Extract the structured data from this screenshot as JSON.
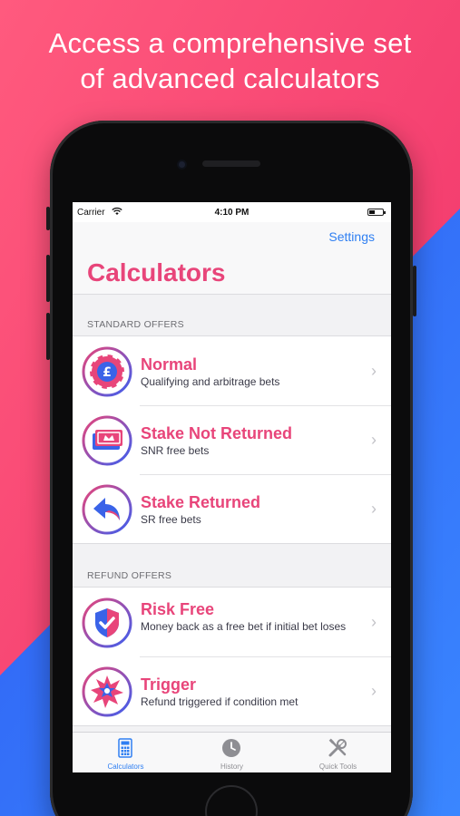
{
  "headline": {
    "line1": "Access a comprehensive set",
    "line2": "of advanced calculators"
  },
  "colors": {
    "accent_pink": "#e8457a",
    "link_blue": "#2f7ff2",
    "bg_pink": "#f0446f",
    "bg_blue": "#2f63f0"
  },
  "status_bar": {
    "carrier": "Carrier",
    "time": "4:10 PM"
  },
  "nav": {
    "settings_label": "Settings",
    "title": "Calculators"
  },
  "sections": [
    {
      "header": "STANDARD OFFERS",
      "rows": [
        {
          "title": "Normal",
          "subtitle": "Qualifying and arbitrage bets",
          "icon": "poker-chip-icon"
        },
        {
          "title": "Stake Not Returned",
          "subtitle": "SNR free bets",
          "icon": "banknote-icon"
        },
        {
          "title": "Stake Returned",
          "subtitle": "SR free bets",
          "icon": "return-arrow-icon"
        }
      ]
    },
    {
      "header": "REFUND OFFERS",
      "rows": [
        {
          "title": "Risk Free",
          "subtitle": "Money back as a free bet if initial bet loses",
          "icon": "shield-check-icon"
        },
        {
          "title": "Trigger",
          "subtitle": "Refund triggered if condition met",
          "icon": "burst-star-icon"
        }
      ]
    }
  ],
  "tabs": [
    {
      "label": "Calculators",
      "icon": "calculator-icon",
      "active": true
    },
    {
      "label": "History",
      "icon": "clock-icon",
      "active": false
    },
    {
      "label": "Quick Tools",
      "icon": "tools-icon",
      "active": false
    }
  ]
}
